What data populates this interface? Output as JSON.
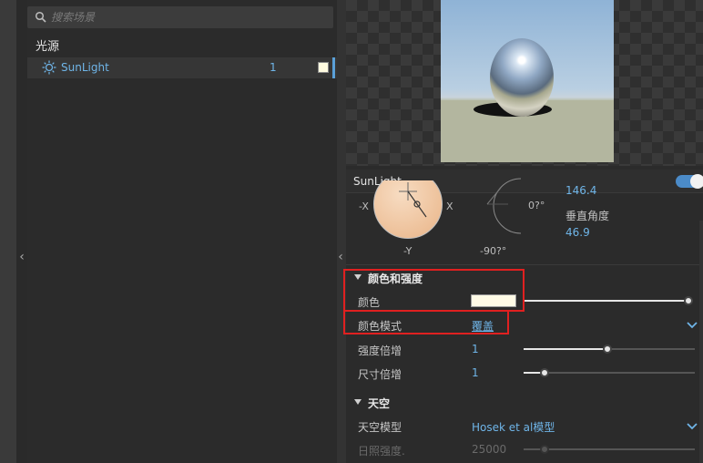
{
  "search": {
    "placeholder": "搜索场景"
  },
  "scene_list": {
    "group_title": "光源",
    "items": [
      {
        "name": "SunLight",
        "count": "1",
        "swatch_color": "#fffbe0",
        "icon": "sun-icon"
      }
    ]
  },
  "inspector": {
    "title": "SunLight",
    "toggle_on": true,
    "direction": {
      "axis_neg_x": "-X",
      "axis_x": "X",
      "axis_neg_y": "-Y",
      "angle_top_label": "0?°",
      "angle_bottom_label": "-90?°",
      "horizontal_angle_value": "146.4",
      "vertical_angle_label": "垂直角度",
      "vertical_angle_value": "46.9"
    },
    "color_section": {
      "title": "颜色和强度",
      "color_label": "颜色",
      "color_value": "#fffbe6",
      "color_mode_label": "颜色模式",
      "color_mode_value": "覆盖",
      "intensity_label": "强度倍增",
      "intensity_value": "1",
      "intensity_fraction": 0.49,
      "size_label": "尺寸倍增",
      "size_value": "1",
      "size_fraction": 0.12
    },
    "sky_section": {
      "title": "天空",
      "sky_model_label": "天空模型",
      "sky_model_value": "Hosek et al模型",
      "sunlight_strength_label": "日照强度.",
      "sunlight_strength_value": "25000",
      "sunlight_strength_fraction": 0.12
    }
  },
  "colors": {
    "accent": "#6fb5e8",
    "highlight_box": "#e02020"
  }
}
